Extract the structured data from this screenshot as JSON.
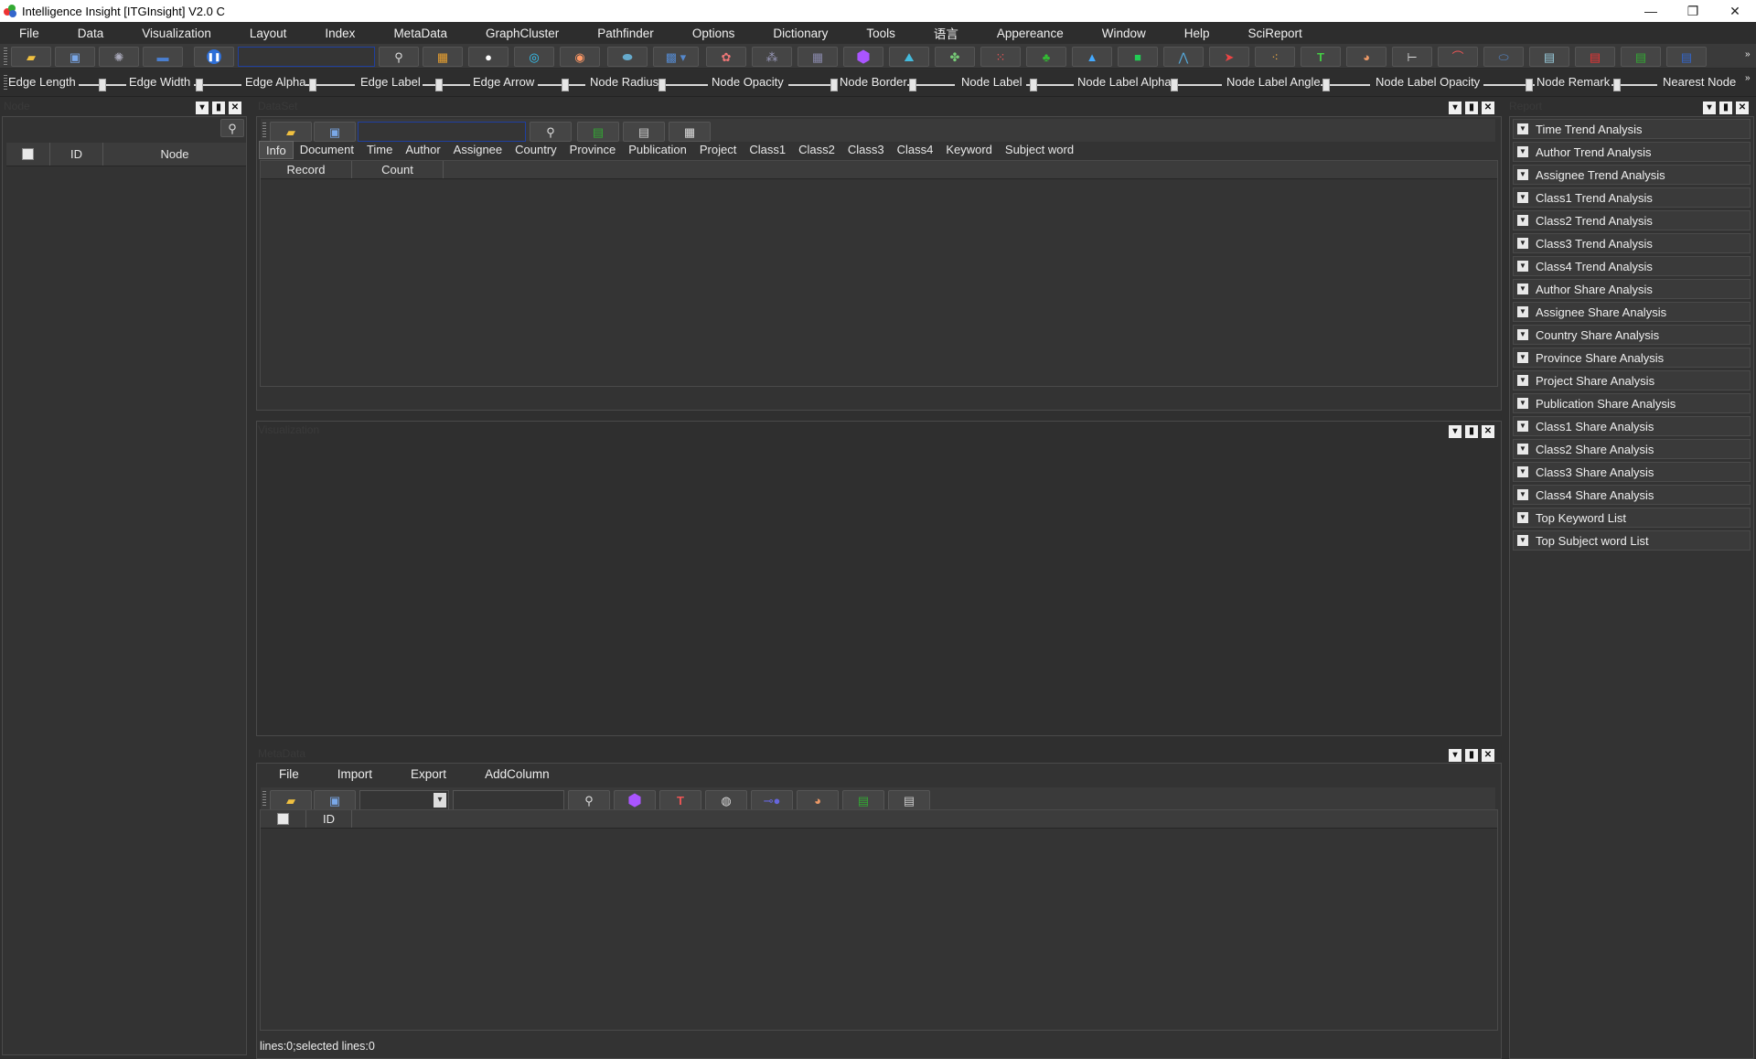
{
  "app": {
    "title": "Intelligence Insight [ITGInsight] V2.0 C"
  },
  "window_controls": {
    "minimize": "—",
    "maximize": "❐",
    "close": "✕"
  },
  "menu": [
    "File",
    "Data",
    "Visualization",
    "Layout",
    "Index",
    "MetaData",
    "GraphCluster",
    "Pathfinder",
    "Options",
    "Dictionary",
    "Tools",
    "语言",
    "Appereance",
    "Window",
    "Help",
    "SciReport"
  ],
  "toolbar_icons": [
    "open-folder-icon",
    "save-icon",
    "network-icon",
    "monitor-icon",
    "pause-icon",
    "search-icon",
    "grid-colors-icon",
    "dark-circle-icon",
    "target-icon",
    "ring-icon",
    "blob-icon",
    "layout-dropdown-icon",
    "cluster-icon",
    "graph-icon",
    "grid-icon",
    "purple-hexagon-icon",
    "map-icon",
    "puzzle-icon",
    "dots-icon",
    "green-tree-icon",
    "peak-icon",
    "square-icon",
    "mountain-icon",
    "arrow-icon",
    "nodes-icon",
    "text-icon",
    "palette-icon",
    "line-icon",
    "curve-icon",
    "oval-icon",
    "window-icon",
    "pdf-icon",
    "excel-icon",
    "word-icon"
  ],
  "sliders": [
    {
      "label": "Edge Length"
    },
    {
      "label": "Edge Width"
    },
    {
      "label": "Edge Alpha"
    },
    {
      "label": "Edge Label"
    },
    {
      "label": "Edge Arrow"
    },
    {
      "label": "Node Radius"
    },
    {
      "label": "Node Opacity"
    },
    {
      "label": "Node Border"
    },
    {
      "label": "Node Label"
    },
    {
      "label": "Node Label Alpha"
    },
    {
      "label": "Node Label Angle"
    },
    {
      "label": "Node Label Opacity"
    },
    {
      "label": "Node Remark"
    },
    {
      "label": "Nearest Node"
    }
  ],
  "node_panel": {
    "title": "Node",
    "columns": [
      "ID",
      "Node"
    ]
  },
  "dataset_panel": {
    "title": "DataSet",
    "tabs": [
      "Info",
      "Document",
      "Time",
      "Author",
      "Assignee",
      "Country",
      "Province",
      "Publication",
      "Project",
      "Class1",
      "Class2",
      "Class3",
      "Class4",
      "Keyword",
      "Subject word"
    ],
    "active_tab": "Info",
    "columns": [
      "Record",
      "Count"
    ]
  },
  "visualization_panel": {
    "title": "Visualization"
  },
  "metadata_panel": {
    "title": "MetaData",
    "menu": [
      "File",
      "Import",
      "Export",
      "AddColumn"
    ],
    "columns": [
      "ID"
    ],
    "status": "lines:0;selected lines:0"
  },
  "report_panel": {
    "title": "Report",
    "items": [
      "Time Trend Analysis",
      "Author Trend Analysis",
      "Assignee Trend Analysis",
      "Class1 Trend Analysis",
      "Class2 Trend Analysis",
      "Class3 Trend Analysis",
      "Class4 Trend Analysis",
      "Author Share Analysis",
      "Assignee Share Analysis",
      "Country Share Analysis",
      "Province Share Analysis",
      "Project Share Analysis",
      "Publication Share Analysis",
      "Class1 Share Analysis",
      "Class2 Share Analysis",
      "Class3 Share Analysis",
      "Class4 Share Analysis",
      "Top Keyword List",
      "Top Subject word List"
    ]
  },
  "panel_controls": {
    "dropdown": "▾",
    "float": "▮",
    "close": "✕"
  }
}
